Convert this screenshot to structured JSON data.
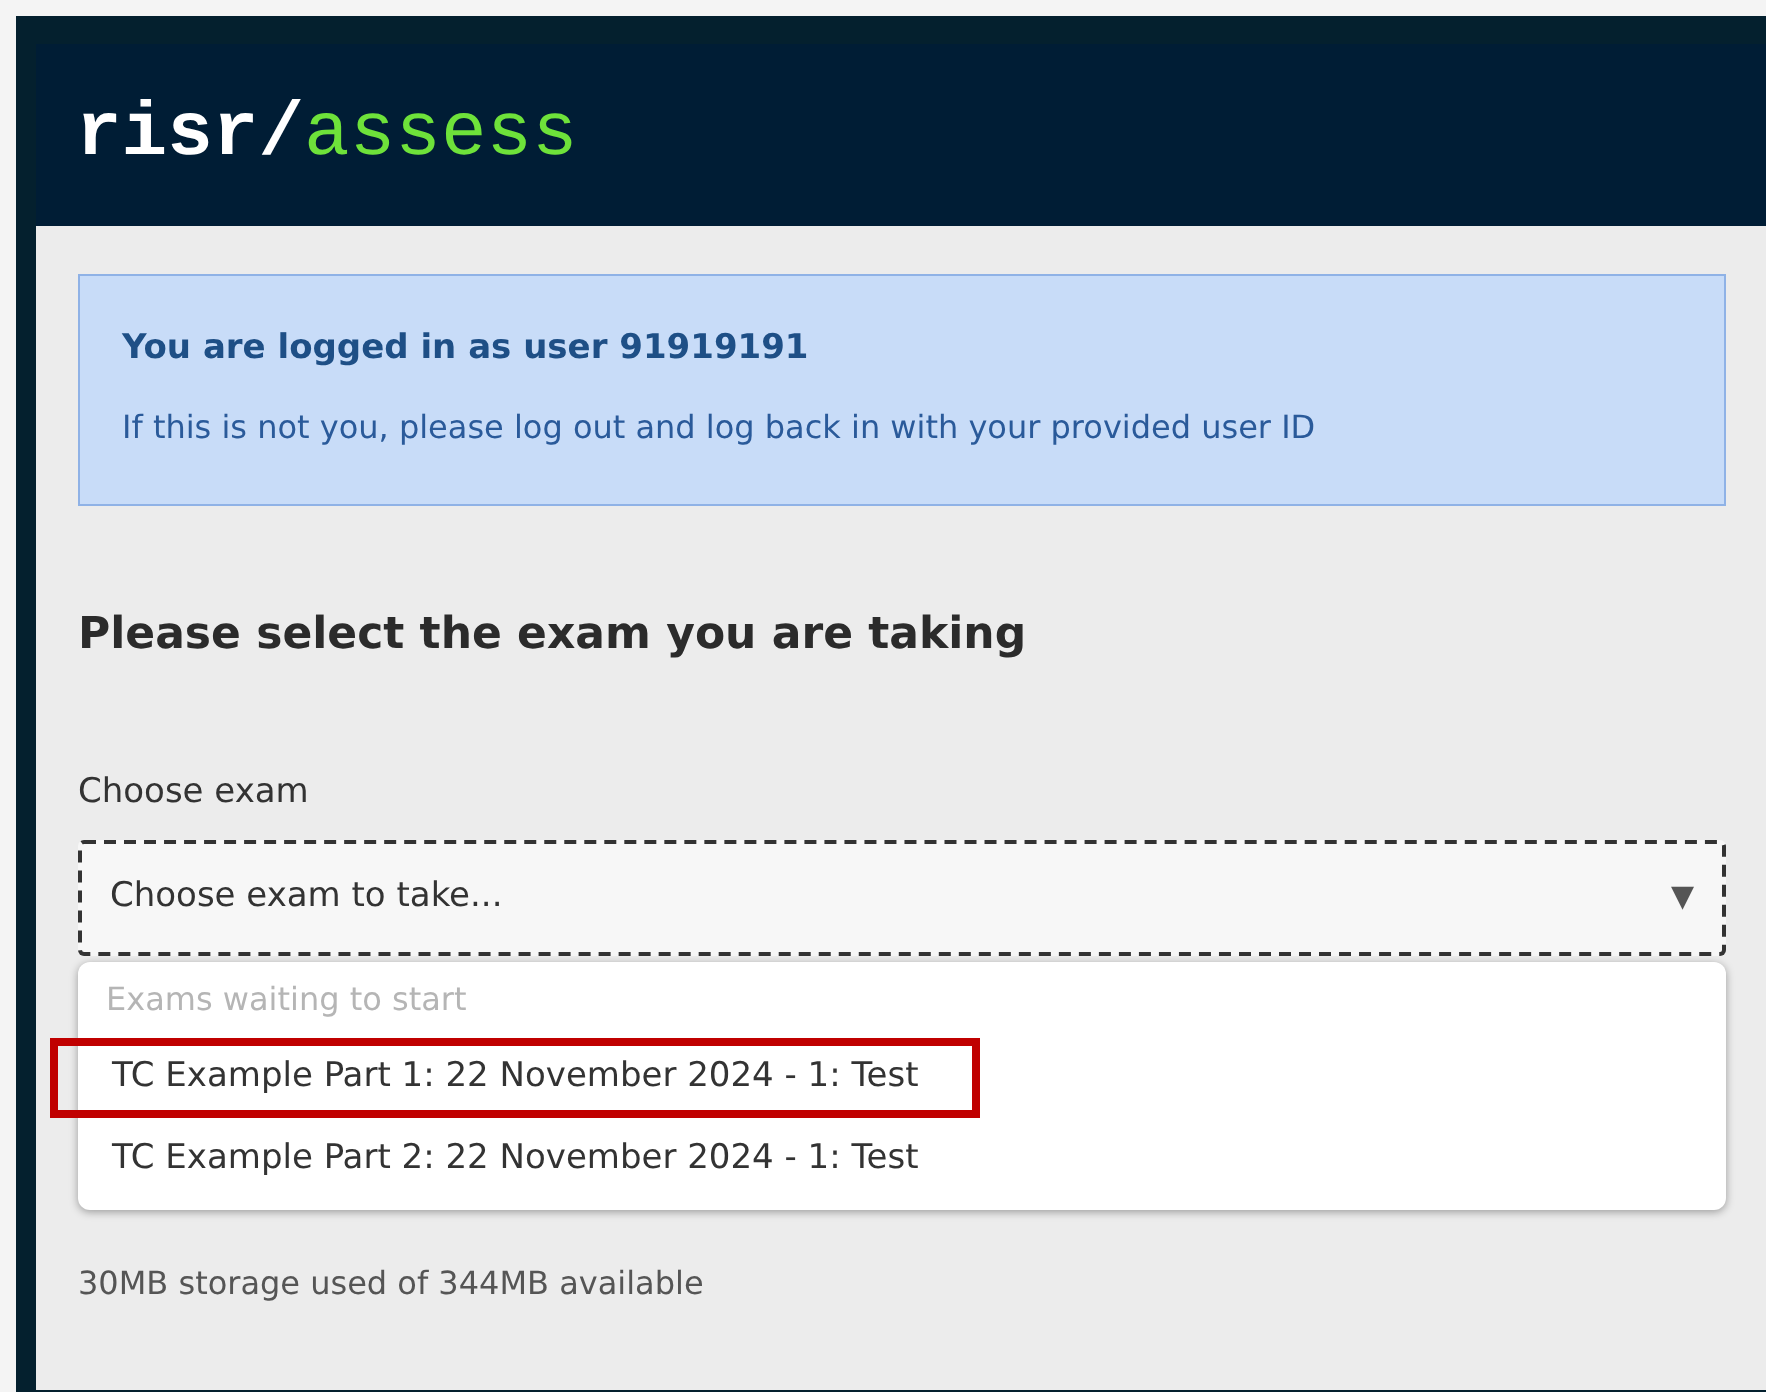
{
  "logo": {
    "part_1": "risr/",
    "part_2": "assess"
  },
  "notice": {
    "title": "You are logged in as user 91919191",
    "text": "If this is not you, please log out and log back in with your provided user ID"
  },
  "heading": "Please select the exam you are taking",
  "exam_select": {
    "label": "Choose exam",
    "placeholder": "Choose exam to take...",
    "arrow": "▼",
    "expanded": true,
    "group_label": "Exams waiting to start",
    "options": [
      {
        "label": "TC Example Part 1: 22 November 2024 - 1: Test",
        "highlighted": true
      },
      {
        "label": "TC Example Part 2: 22 November 2024 - 1: Test",
        "highlighted": false
      }
    ]
  },
  "storage": "30MB storage used of 344MB available"
}
